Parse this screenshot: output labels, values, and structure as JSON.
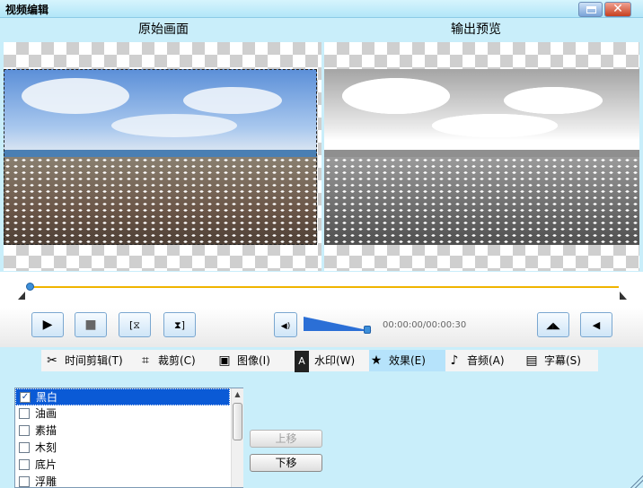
{
  "window": {
    "title": "视频编辑"
  },
  "preview": {
    "original_label": "原始画面",
    "output_label": "输出预览"
  },
  "player": {
    "time_display": "00:00:00/00:00:30",
    "play_symbol": "▶",
    "stop_symbol": "■",
    "mark_in_symbol": "[⧖",
    "mark_out_symbol": "⧗]",
    "volume_symbol": "◀)",
    "flip_h_symbol": "◢◣",
    "flip_v_symbol": "◀",
    "volume_level": 0.95,
    "position_fraction": 0.0
  },
  "tabs": [
    {
      "label": "时间剪辑(T)",
      "icon": "scissors-icon",
      "glyph": "✂"
    },
    {
      "label": "裁剪(C)",
      "icon": "crop-icon",
      "glyph": "⌗"
    },
    {
      "label": "图像(I)",
      "icon": "image-icon",
      "glyph": "▣"
    },
    {
      "label": "水印(W)",
      "icon": "watermark-icon",
      "glyph": "A"
    },
    {
      "label": "效果(E)",
      "icon": "star-icon",
      "glyph": "★",
      "active": true
    },
    {
      "label": "音频(A)",
      "icon": "music-note-icon",
      "glyph": "♪"
    },
    {
      "label": "字幕(S)",
      "icon": "subtitle-icon",
      "glyph": "▤"
    }
  ],
  "effects": [
    {
      "label": "黑白",
      "checked": true,
      "selected": true
    },
    {
      "label": "油画",
      "checked": false
    },
    {
      "label": "素描",
      "checked": false
    },
    {
      "label": "木刻",
      "checked": false
    },
    {
      "label": "底片",
      "checked": false
    },
    {
      "label": "浮雕",
      "checked": false
    }
  ],
  "buttons": {
    "move_up": "上移",
    "move_down": "下移"
  },
  "colors": {
    "accent": "#0a5ad6",
    "timeline": "#f0b400",
    "background": "#c9eefa"
  }
}
